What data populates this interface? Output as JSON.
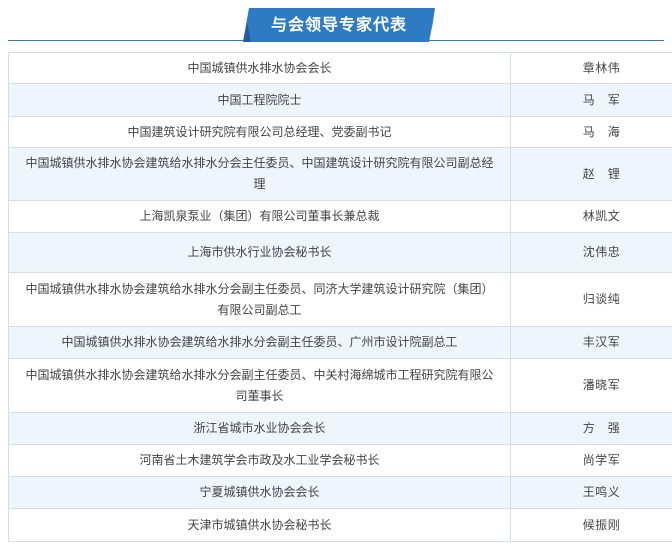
{
  "title": "与会领导专家代表",
  "colors": {
    "accent": "#2e7bc4",
    "row_alt": "#eef5fd",
    "border": "#d6dde6"
  },
  "rows": [
    {
      "org": "中国城镇供水排水协会会长",
      "name": "章林伟"
    },
    {
      "org": "中国工程院院士",
      "name": "马　军"
    },
    {
      "org": "中国建筑设计研究院有限公司总经理、党委副书记",
      "name": "马　海"
    },
    {
      "org": "中国城镇供水排水协会建筑给水排水分会主任委员、中国建筑设计研究院有限公司副总经理",
      "name": "赵　锂"
    },
    {
      "org": "上海凯泉泵业（集团）有限公司董事长兼总裁",
      "name": "林凯文"
    },
    {
      "org": "上海市供水行业协会秘书长",
      "name": "沈伟忠"
    },
    {
      "org": "中国城镇供水排水协会建筑给水排水分会副主任委员、同济大学建筑设计研究院（集团）有限公司副总工",
      "name": "归谈纯"
    },
    {
      "org": "中国城镇供水排水协会建筑给水排水分会副主任委员、广州市设计院副总工",
      "name": "丰汉军"
    },
    {
      "org": "中国城镇供水排水协会建筑给水排水分会副主任委员、中关村海绵城市工程研究院有限公司董事长",
      "name": "潘晓军"
    },
    {
      "org": "浙江省城市水业协会会长",
      "name": "方　强"
    },
    {
      "org": "河南省土木建筑学会市政及水工业学会秘书长",
      "name": "尚学军"
    },
    {
      "org": "宁夏城镇供水协会会长",
      "name": "王鸣义"
    },
    {
      "org": "天津市城镇供水协会秘书长",
      "name": "候振刚"
    }
  ]
}
